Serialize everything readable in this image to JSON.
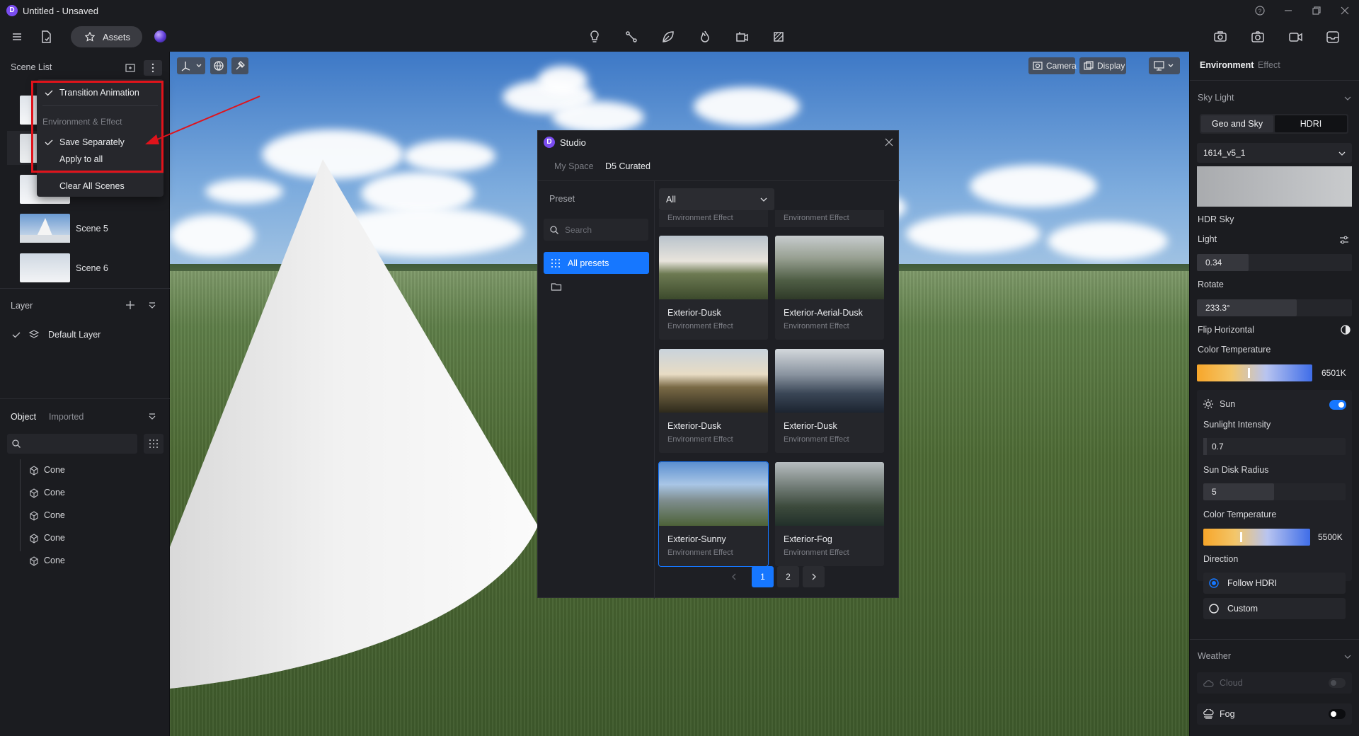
{
  "window": {
    "logo": "D",
    "title": "Untitled - Unsaved"
  },
  "toolbar": {
    "assets_label": "Assets",
    "icons": [
      "menu-icon",
      "file-sync-icon",
      "assets-icon",
      "light-icon",
      "path-icon",
      "leaf-icon",
      "fire-icon",
      "vr-icon",
      "frame-icon",
      "render-icon",
      "camera-icon",
      "video-icon",
      "inbox-icon"
    ]
  },
  "scene_list": {
    "title": "Scene List",
    "scenes": [
      {
        "label": "Scene 5"
      },
      {
        "label": "Scene 6"
      }
    ]
  },
  "context_menu": {
    "transition_animation": "Transition Animation",
    "env_section": "Environment & Effect",
    "save_separately": "Save Separately",
    "apply_to_all": "Apply to all",
    "clear_all": "Clear All Scenes"
  },
  "layer": {
    "title": "Layer",
    "default_layer": "Default Layer"
  },
  "objects": {
    "tab_object": "Object",
    "tab_imported": "Imported",
    "items": [
      "Cone",
      "Cone",
      "Cone",
      "Cone",
      "Cone"
    ]
  },
  "viewport": {
    "camera_label": "Camera",
    "display_label": "Display"
  },
  "studio": {
    "title": "Studio",
    "tab_my_space": "My Space",
    "tab_curated": "D5 Curated",
    "preset_label": "Preset",
    "search_placeholder": "Search",
    "all_presets": "All presets",
    "filter_value": "All",
    "partial_cards": [
      "Environment Effect",
      "Environment Effect"
    ],
    "cards": [
      {
        "title": "Exterior-Dusk",
        "subtitle": "Environment Effect"
      },
      {
        "title": "Exterior-Aerial-Dusk",
        "subtitle": "Environment Effect"
      },
      {
        "title": "Exterior-Dusk",
        "subtitle": "Environment Effect"
      },
      {
        "title": "Exterior-Dusk",
        "subtitle": "Environment Effect"
      },
      {
        "title": "Exterior-Sunny",
        "subtitle": "Environment Effect"
      },
      {
        "title": "Exterior-Fog",
        "subtitle": "Environment Effect"
      }
    ],
    "pages": [
      "1",
      "2"
    ],
    "current_page": "1"
  },
  "right_panel": {
    "tab_environment": "Environment",
    "tab_effect": "Effect",
    "sky_light": "Sky Light",
    "seg_geo": "Geo and Sky",
    "seg_hdri": "HDRI",
    "hdri_name": "1614_v5_1",
    "hdr_sky": "HDR Sky",
    "light_label": "Light",
    "light_value": "0.34",
    "rotate_label": "Rotate",
    "rotate_value": "233.3°",
    "flip_label": "Flip Horizontal",
    "color_temp_label": "Color Temperature",
    "color_temp_value": "6501K",
    "sun_label": "Sun",
    "sunlight_label": "Sunlight Intensity",
    "sunlight_value": "0.7",
    "sun_disk_label": "Sun Disk Radius",
    "sun_disk_value": "5",
    "sun_temp_label": "Color Temperature",
    "sun_temp_value": "5500K",
    "direction_label": "Direction",
    "follow_hdri": "Follow HDRI",
    "custom": "Custom",
    "weather_label": "Weather",
    "cloud_label": "Cloud",
    "fog_label": "Fog"
  },
  "colors": {
    "accent": "#1677ff",
    "annotation": "#e0131b"
  }
}
